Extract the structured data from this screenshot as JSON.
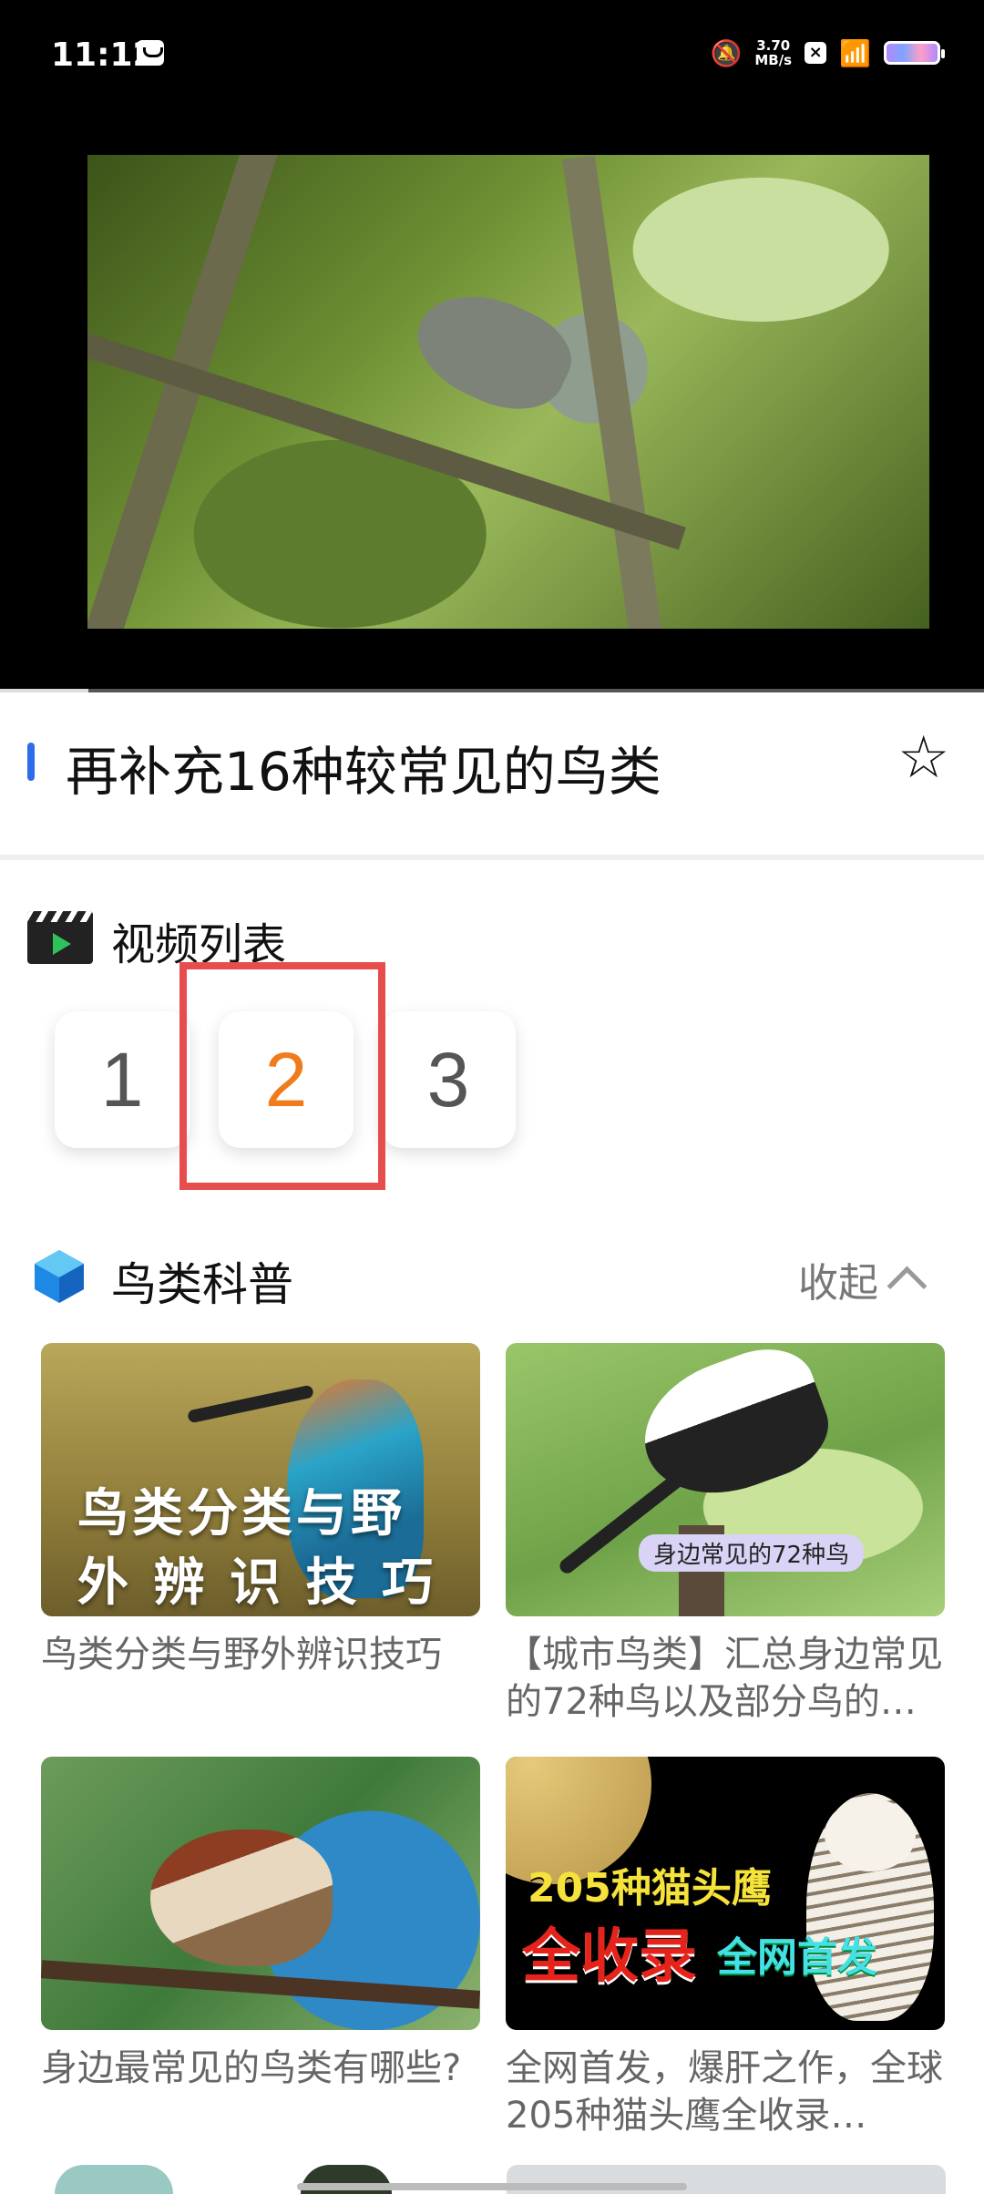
{
  "status_bar": {
    "time": "11:12",
    "net_speed_value": "3.70",
    "net_speed_unit": "MB/s",
    "icons": [
      "message-icon",
      "bell-off-icon",
      "close-box-icon",
      "wifi-icon",
      "battery-icon"
    ]
  },
  "video": {
    "progress_fraction": 0.09
  },
  "page": {
    "title": "再补充16种较常见的鸟类",
    "accent_color": "#2d6ee8"
  },
  "video_list": {
    "title": "视频列表",
    "episodes": [
      "1",
      "2",
      "3"
    ],
    "active_episode": "2",
    "active_color": "#f07b1a",
    "highlight_color": "#e84d4d"
  },
  "bird_science": {
    "title": "鸟类科普",
    "collapse_label": "收起",
    "cards": [
      {
        "caption": "鸟类分类与野外辨识技巧",
        "thumb_text": [
          "鸟类分类与野",
          "外 辨 识 技 巧"
        ]
      },
      {
        "caption": "【城市鸟类】汇总身边常见的72种鸟以及部分鸟的…",
        "thumb_text": [
          "身边常见的72种鸟"
        ]
      },
      {
        "caption": "身边最常见的鸟类有哪些?",
        "thumb_text": []
      },
      {
        "caption": "全网首发，爆肝之作，全球205种猫头鹰全收录…",
        "thumb_text": [
          "205种猫头鹰",
          "全收录",
          "全网首发"
        ]
      }
    ]
  }
}
